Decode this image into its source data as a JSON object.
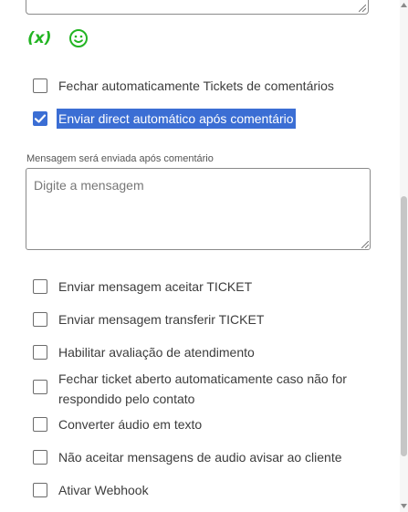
{
  "toolbar": {
    "var_icon": "(x)",
    "emoji_icon": "smiley-face-icon"
  },
  "options_top": [
    {
      "label": "Fechar automaticamente Tickets de comentários",
      "checked": false
    },
    {
      "label": "Enviar direct automático após comentário",
      "checked": true
    }
  ],
  "message": {
    "label": "Mensagem será enviada após comentário",
    "placeholder": "Digite a mensagem"
  },
  "options_bottom": [
    {
      "label": "Enviar mensagem aceitar TICKET",
      "checked": false
    },
    {
      "label": "Enviar mensagem transferir TICKET",
      "checked": false
    },
    {
      "label": "Habilitar avaliação de atendimento",
      "checked": false
    },
    {
      "label": "Fechar ticket aberto automaticamente caso não for respondido pelo contato",
      "checked": false
    },
    {
      "label": "Converter áudio em texto",
      "checked": false
    },
    {
      "label": "Não aceitar mensagens de audio avisar ao cliente",
      "checked": false
    },
    {
      "label": "Ativar Webhook",
      "checked": false
    }
  ],
  "colors": {
    "accent": "#3b6ed4",
    "icon_green": "#22b422"
  }
}
